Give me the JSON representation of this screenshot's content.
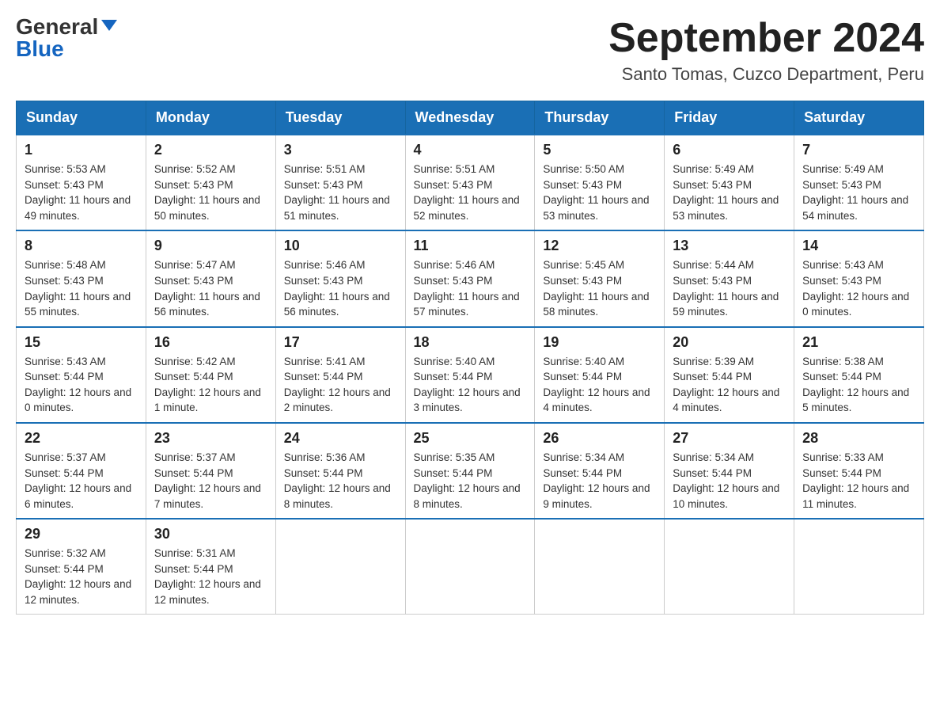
{
  "header": {
    "logo_general": "General",
    "logo_blue": "Blue",
    "month_title": "September 2024",
    "location": "Santo Tomas, Cuzco Department, Peru"
  },
  "days_of_week": [
    "Sunday",
    "Monday",
    "Tuesday",
    "Wednesday",
    "Thursday",
    "Friday",
    "Saturday"
  ],
  "weeks": [
    [
      {
        "day": "1",
        "sunrise": "5:53 AM",
        "sunset": "5:43 PM",
        "daylight": "11 hours and 49 minutes."
      },
      {
        "day": "2",
        "sunrise": "5:52 AM",
        "sunset": "5:43 PM",
        "daylight": "11 hours and 50 minutes."
      },
      {
        "day": "3",
        "sunrise": "5:51 AM",
        "sunset": "5:43 PM",
        "daylight": "11 hours and 51 minutes."
      },
      {
        "day": "4",
        "sunrise": "5:51 AM",
        "sunset": "5:43 PM",
        "daylight": "11 hours and 52 minutes."
      },
      {
        "day": "5",
        "sunrise": "5:50 AM",
        "sunset": "5:43 PM",
        "daylight": "11 hours and 53 minutes."
      },
      {
        "day": "6",
        "sunrise": "5:49 AM",
        "sunset": "5:43 PM",
        "daylight": "11 hours and 53 minutes."
      },
      {
        "day": "7",
        "sunrise": "5:49 AM",
        "sunset": "5:43 PM",
        "daylight": "11 hours and 54 minutes."
      }
    ],
    [
      {
        "day": "8",
        "sunrise": "5:48 AM",
        "sunset": "5:43 PM",
        "daylight": "11 hours and 55 minutes."
      },
      {
        "day": "9",
        "sunrise": "5:47 AM",
        "sunset": "5:43 PM",
        "daylight": "11 hours and 56 minutes."
      },
      {
        "day": "10",
        "sunrise": "5:46 AM",
        "sunset": "5:43 PM",
        "daylight": "11 hours and 56 minutes."
      },
      {
        "day": "11",
        "sunrise": "5:46 AM",
        "sunset": "5:43 PM",
        "daylight": "11 hours and 57 minutes."
      },
      {
        "day": "12",
        "sunrise": "5:45 AM",
        "sunset": "5:43 PM",
        "daylight": "11 hours and 58 minutes."
      },
      {
        "day": "13",
        "sunrise": "5:44 AM",
        "sunset": "5:43 PM",
        "daylight": "11 hours and 59 minutes."
      },
      {
        "day": "14",
        "sunrise": "5:43 AM",
        "sunset": "5:43 PM",
        "daylight": "12 hours and 0 minutes."
      }
    ],
    [
      {
        "day": "15",
        "sunrise": "5:43 AM",
        "sunset": "5:44 PM",
        "daylight": "12 hours and 0 minutes."
      },
      {
        "day": "16",
        "sunrise": "5:42 AM",
        "sunset": "5:44 PM",
        "daylight": "12 hours and 1 minute."
      },
      {
        "day": "17",
        "sunrise": "5:41 AM",
        "sunset": "5:44 PM",
        "daylight": "12 hours and 2 minutes."
      },
      {
        "day": "18",
        "sunrise": "5:40 AM",
        "sunset": "5:44 PM",
        "daylight": "12 hours and 3 minutes."
      },
      {
        "day": "19",
        "sunrise": "5:40 AM",
        "sunset": "5:44 PM",
        "daylight": "12 hours and 4 minutes."
      },
      {
        "day": "20",
        "sunrise": "5:39 AM",
        "sunset": "5:44 PM",
        "daylight": "12 hours and 4 minutes."
      },
      {
        "day": "21",
        "sunrise": "5:38 AM",
        "sunset": "5:44 PM",
        "daylight": "12 hours and 5 minutes."
      }
    ],
    [
      {
        "day": "22",
        "sunrise": "5:37 AM",
        "sunset": "5:44 PM",
        "daylight": "12 hours and 6 minutes."
      },
      {
        "day": "23",
        "sunrise": "5:37 AM",
        "sunset": "5:44 PM",
        "daylight": "12 hours and 7 minutes."
      },
      {
        "day": "24",
        "sunrise": "5:36 AM",
        "sunset": "5:44 PM",
        "daylight": "12 hours and 8 minutes."
      },
      {
        "day": "25",
        "sunrise": "5:35 AM",
        "sunset": "5:44 PM",
        "daylight": "12 hours and 8 minutes."
      },
      {
        "day": "26",
        "sunrise": "5:34 AM",
        "sunset": "5:44 PM",
        "daylight": "12 hours and 9 minutes."
      },
      {
        "day": "27",
        "sunrise": "5:34 AM",
        "sunset": "5:44 PM",
        "daylight": "12 hours and 10 minutes."
      },
      {
        "day": "28",
        "sunrise": "5:33 AM",
        "sunset": "5:44 PM",
        "daylight": "12 hours and 11 minutes."
      }
    ],
    [
      {
        "day": "29",
        "sunrise": "5:32 AM",
        "sunset": "5:44 PM",
        "daylight": "12 hours and 12 minutes."
      },
      {
        "day": "30",
        "sunrise": "5:31 AM",
        "sunset": "5:44 PM",
        "daylight": "12 hours and 12 minutes."
      },
      null,
      null,
      null,
      null,
      null
    ]
  ]
}
